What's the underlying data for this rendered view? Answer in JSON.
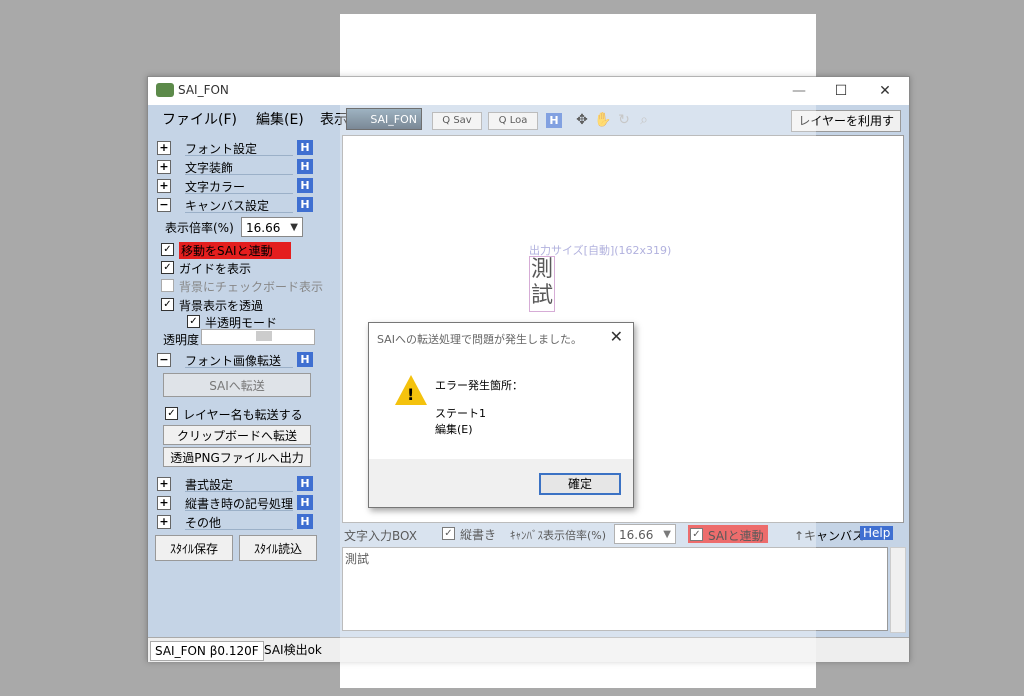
{
  "window": {
    "title": "SAI_FON",
    "minimize": "—",
    "maximize": "☐",
    "close": "✕"
  },
  "menu": {
    "file": "ファイル(F)",
    "edit": "編集(E)",
    "view": "表示"
  },
  "toolbar": {
    "logo": "SAI_FON",
    "save": "Q Sav",
    "load": "Q Loa",
    "h": "H",
    "use_layer": "レイヤーを利用す"
  },
  "panel": {
    "sections": {
      "font_settings": "フォント設定",
      "text_decoration": "文字装飾",
      "text_color": "文字カラー",
      "canvas_settings": "キャンバス設定",
      "font_image_transfer": "フォント画像転送",
      "format_settings": "書式設定",
      "vertical_symbols": "縦書き時の記号処理",
      "other": "その他"
    },
    "h": "H",
    "zoom_label": "表示倍率(%)",
    "zoom_value": "16.66",
    "sync_move": "移動をSAIと連動",
    "show_guide": "ガイドを表示",
    "checker_bg": "背景にチェックボード表示",
    "transparent_bg": "背景表示を透過",
    "semi_mode": "半透明モード",
    "transparency": "透明度",
    "send_sai": "SAIへ転送",
    "send_layer_name": "レイヤー名も転送する",
    "to_clipboard": "クリップボードへ転送",
    "to_png": "透過PNGファイルへ出力",
    "style_save": "ｽﾀｲﾙ保存",
    "style_load": "ｽﾀｲﾙ読込"
  },
  "canvas": {
    "output_size": "出力サイズ[自動](162x319)",
    "vertical_text": "測\n試"
  },
  "bottom": {
    "input_box": "文字入力BOX",
    "vertical": "縦書き",
    "canvas_zoom": "ｷｬﾝﾊﾞｽ表示倍率(%)",
    "canvas_zoom_value": "16.66",
    "sai_link": "SAIと連動",
    "canvas_up": "↑キャンバス",
    "help": "Help",
    "text": "測試"
  },
  "status": {
    "version": "SAI_FON β0.120F",
    "detect": "SAI検出ok"
  },
  "dialog": {
    "title": "SAIへの転送処理で問題が発生しました。",
    "line1": "エラー発生箇所：",
    "line2": "ステート1",
    "line3": "編集(E)",
    "ok": "確定"
  }
}
